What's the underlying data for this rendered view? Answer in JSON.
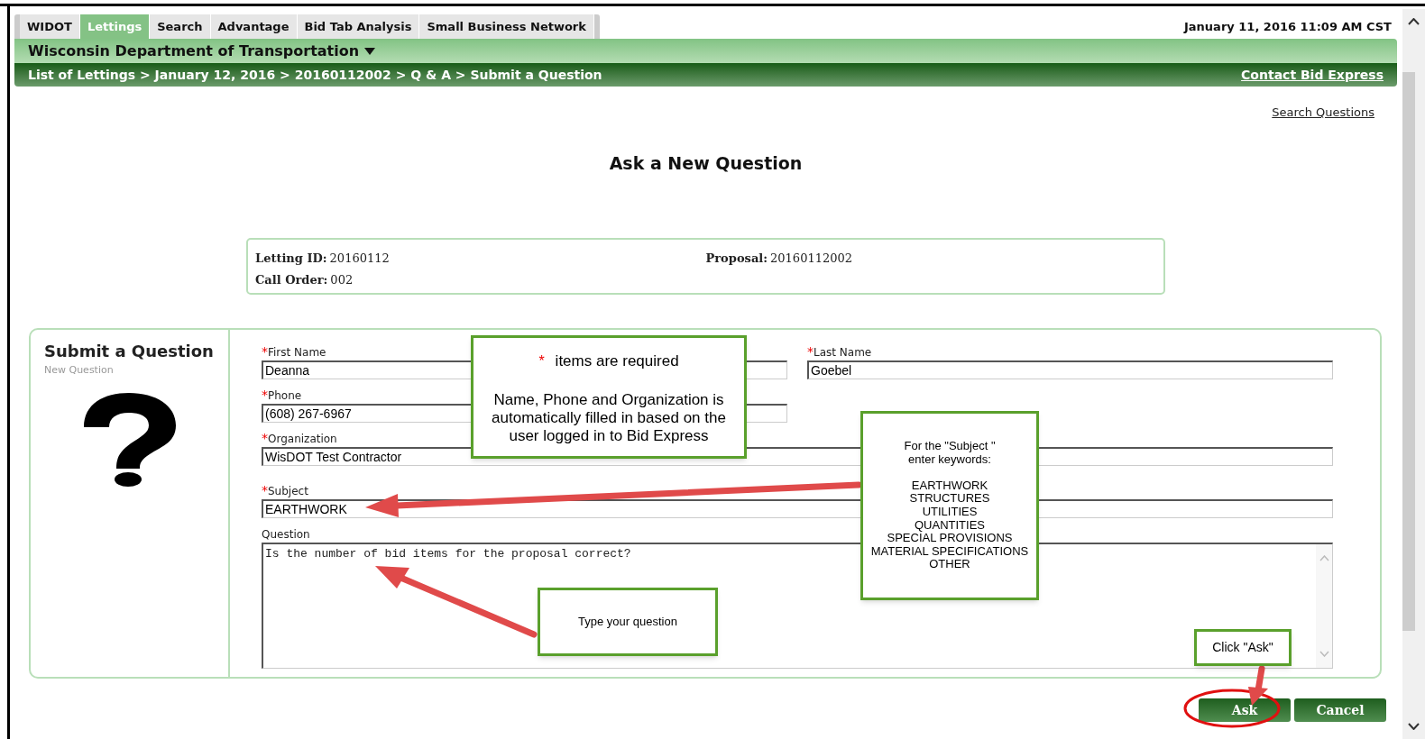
{
  "tabs": [
    {
      "label": "WIDOT",
      "selected": false
    },
    {
      "label": "Lettings",
      "selected": true
    },
    {
      "label": "Search",
      "selected": false
    },
    {
      "label": "Advantage",
      "selected": false
    },
    {
      "label": "Bid Tab Analysis",
      "selected": false
    },
    {
      "label": "Small Business Network",
      "selected": false
    }
  ],
  "datetime": "January 11, 2016 11:09 AM CST",
  "agency": "Wisconsin Department of Transportation",
  "breadcrumb": "List of Lettings > January 12, 2016 > 20160112002 > Q & A > Submit a Question",
  "contact_link": "Contact Bid Express",
  "search_link": "Search Questions",
  "title": "Ask a New Question",
  "info": [
    {
      "label": "Letting ID:",
      "value": "20160112"
    },
    {
      "label": "Proposal:",
      "value": "20160112002"
    },
    {
      "label": "Call Order:",
      "value": "002"
    }
  ],
  "form": {
    "heading": "Submit a Question",
    "subheading": "New Question",
    "rows": [
      {
        "kind": "pair",
        "fields": [
          {
            "label": "First Name",
            "required": true,
            "kind": "input",
            "value": "Deanna"
          },
          {
            "label": "Last Name",
            "required": true,
            "kind": "input",
            "value": "Goebel"
          }
        ]
      },
      {
        "kind": "pair",
        "fields": [
          {
            "label": "Phone",
            "required": true,
            "kind": "input",
            "value": "(608) 267-6967"
          }
        ]
      },
      {
        "kind": "full",
        "fields": [
          {
            "label": "Organization",
            "required": true,
            "kind": "input",
            "value": "WisDOT Test Contractor"
          }
        ]
      },
      {
        "kind": "full",
        "fields": [
          {
            "label": "Subject",
            "required": true,
            "kind": "input",
            "value": "EARTHWORK"
          }
        ]
      },
      {
        "kind": "full",
        "fields": [
          {
            "label": "Question",
            "required": false,
            "kind": "textarea",
            "value": "Is the number of bid items for the proposal correct?"
          }
        ]
      }
    ]
  },
  "buttons": [
    {
      "label": "Ask"
    },
    {
      "label": "Cancel"
    }
  ],
  "callouts": [
    {
      "kind": "required",
      "star": "*",
      "text": "items are required",
      "body": "Name, Phone and Organization is automatically filled in based on the user logged in to Bid Express"
    },
    {
      "kind": "plain",
      "text": "For the \"Subject \"\nenter keywords:\n\nEARTHWORK\nSTRUCTURES\nUTILITIES\nQUANTITIES\nSPECIAL PROVISIONS\nMATERIAL SPECIFICATIONS\nOTHER"
    },
    {
      "kind": "plain",
      "text": "Type your question"
    },
    {
      "kind": "plain",
      "text": "Click \"Ask\""
    }
  ]
}
